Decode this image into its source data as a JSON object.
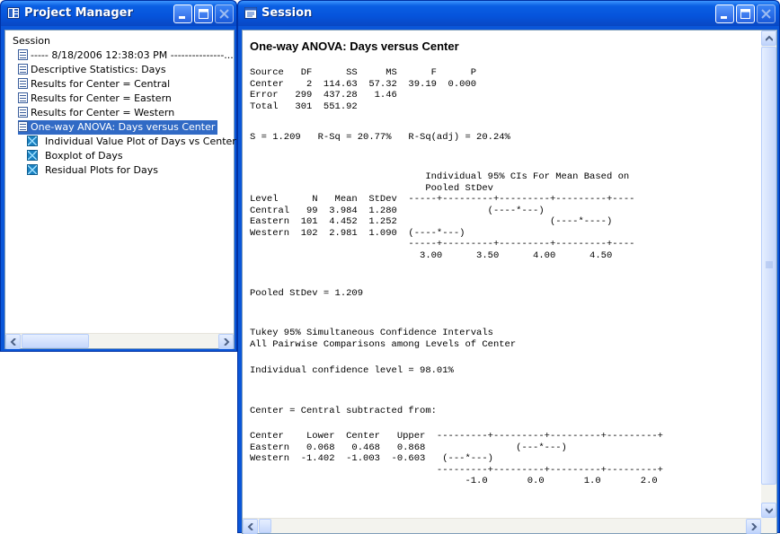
{
  "project_manager": {
    "title": "Project Manager",
    "header": "Session",
    "items": [
      {
        "label": "----- 8/18/2006 12:38:03 PM ---------------...",
        "icon": "document-icon"
      },
      {
        "label": "Descriptive Statistics: Days",
        "icon": "document-icon"
      },
      {
        "label": "Results for Center = Central",
        "icon": "document-icon"
      },
      {
        "label": "Results for Center = Eastern",
        "icon": "document-icon"
      },
      {
        "label": "Results for Center = Western",
        "icon": "document-icon"
      },
      {
        "label": "One-way ANOVA: Days versus Center",
        "icon": "document-icon",
        "selected": true
      },
      {
        "label": "Individual Value Plot of Days vs Center",
        "icon": "graph-icon"
      },
      {
        "label": "Boxplot of Days",
        "icon": "graph-icon"
      },
      {
        "label": "Residual Plots for Days",
        "icon": "graph-icon"
      }
    ]
  },
  "session": {
    "title": "Session",
    "heading": "One-way ANOVA: Days versus Center",
    "anova_table": "Source   DF      SS     MS      F      P\nCenter    2  114.63  57.32  39.19  0.000\nError   299  437.28   1.46\nTotal   301  551.92",
    "fit_stats": "S = 1.209   R-Sq = 20.77%   R-Sq(adj) = 20.24%",
    "ci_table": "                               Individual 95% CIs For Mean Based on\n                               Pooled StDev\nLevel      N   Mean  StDev  -----+---------+---------+---------+----\nCentral   99  3.984  1.280                (----*---)\nEastern  101  4.452  1.252                           (----*----)\nWestern  102  2.981  1.090  (----*---)\n                            -----+---------+---------+---------+----\n                              3.00      3.50      4.00      4.50",
    "pooled": "Pooled StDev = 1.209",
    "tukey_header": "Tukey 95% Simultaneous Confidence Intervals\nAll Pairwise Comparisons among Levels of Center",
    "confidence": "Individual confidence level = 98.01%",
    "subtracted": "Center = Central subtracted from:",
    "tukey_table": "Center    Lower  Center   Upper  ---------+---------+---------+---------+\nEastern   0.068   0.468   0.868                (---*---)\nWestern  -1.402  -1.003  -0.603   (---*---)\n                                 ---------+---------+---------+---------+\n                                      -1.0       0.0       1.0       2.0"
  }
}
